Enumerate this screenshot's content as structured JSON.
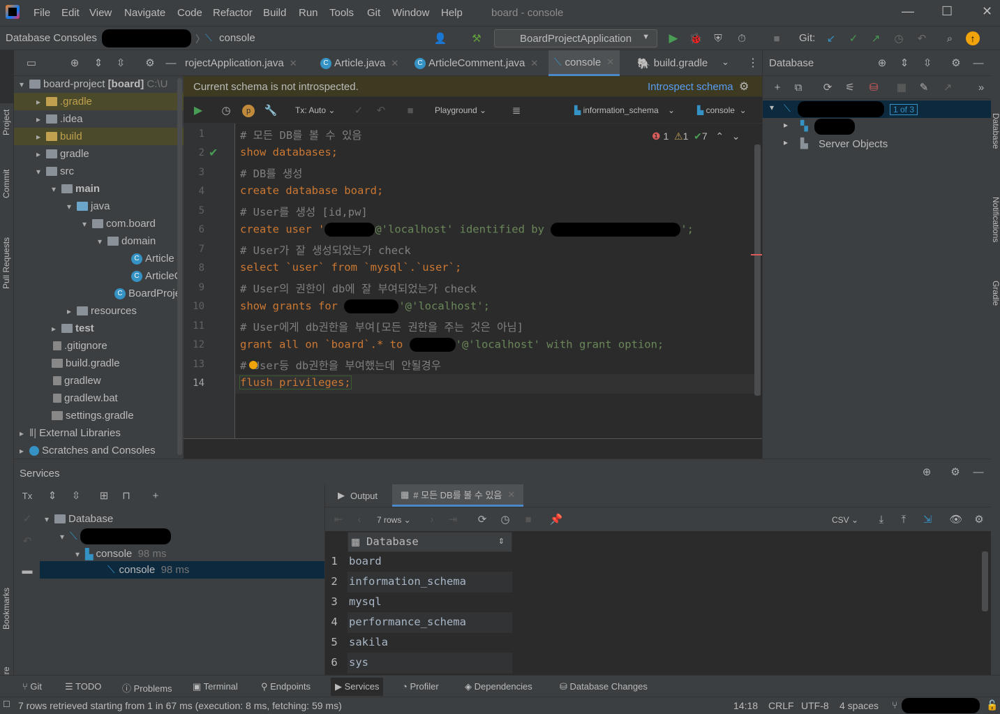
{
  "menu": [
    "File",
    "Edit",
    "View",
    "Navigate",
    "Code",
    "Refactor",
    "Build",
    "Run",
    "Tools",
    "Git",
    "Window",
    "Help"
  ],
  "window_title": "board - console",
  "breadcrumb": {
    "root": "Database Consoles",
    "leaf": "console"
  },
  "run_config": "BoardProjectApplication",
  "git_label": "Git:",
  "left_stripe": [
    "Project",
    "Commit",
    "Pull Requests",
    "Bookmarks",
    "Structure"
  ],
  "right_stripe": [
    "Database",
    "Notifications",
    "Gradle"
  ],
  "project_tree": [
    {
      "label": "board-project",
      "bold": "[board]",
      "extra": "C:\\U"
    },
    {
      "label": ".gradle"
    },
    {
      "label": ".idea"
    },
    {
      "label": "build"
    },
    {
      "label": "gradle"
    },
    {
      "label": "src"
    },
    {
      "label": "main"
    },
    {
      "label": "java"
    },
    {
      "label": "com.board"
    },
    {
      "label": "domain"
    },
    {
      "label": "Article"
    },
    {
      "label": "ArticleC"
    },
    {
      "label": "BoardProje"
    },
    {
      "label": "resources"
    },
    {
      "label": "test"
    },
    {
      "label": ".gitignore"
    },
    {
      "label": "build.gradle"
    },
    {
      "label": "gradlew"
    },
    {
      "label": "gradlew.bat"
    },
    {
      "label": "settings.gradle"
    },
    {
      "label": "External Libraries"
    },
    {
      "label": "Scratches and Consoles"
    }
  ],
  "tabs": [
    "rojectApplication.java",
    "Article.java",
    "ArticleComment.java",
    "console",
    "build.gradle"
  ],
  "schema_bar": {
    "message": "Current schema is not introspected.",
    "action": "Introspect schema"
  },
  "editor_toolbar": {
    "tx": "Tx: Auto",
    "mode": "Playground",
    "schema": "information_schema",
    "session": "console"
  },
  "inspections": {
    "errors": "1",
    "warnings": "1",
    "ok": "7"
  },
  "code_lines": [
    "# 모든 DB를 볼 수 있음",
    "show databases;",
    "# DB를 생성",
    "create database board;",
    "# User를 생성 [id,pw]",
    "create user '",
    "# User가 잘 생성되었는가 check",
    "select `user` from `mysql`.`user`;",
    "# User의 권한이 db에 잘 부여되었는가 check",
    "show grants for",
    "# User에게 db권한을 부여[모든 권한을 주는 것은 아님]",
    "grant all on `board`.* to",
    "# User등 db권한을 부여했는데 안될경우",
    "flush privileges;"
  ],
  "code_parts": {
    "l6_host": "@'localhost' identified by ",
    "l6_end": "';",
    "l10_host": "'@'localhost';",
    "l12_host": "'@'localhost' with grant option;"
  },
  "line_numbers": [
    "1",
    "2",
    "3",
    "4",
    "5",
    "6",
    "7",
    "8",
    "9",
    "10",
    "11",
    "12",
    "13",
    "14"
  ],
  "db_panel": {
    "title": "Database",
    "counter": "1 of 3",
    "server_objects": "Server Objects"
  },
  "services": {
    "title": "Services",
    "tree": [
      {
        "label": "Database"
      },
      {
        "label": "console",
        "time": "98 ms"
      },
      {
        "label": "console",
        "time": "98 ms"
      }
    ],
    "tabs": [
      "Output",
      "# 모든 DB를 볼 수 있음"
    ],
    "rows_label": "7 rows",
    "export": "CSV",
    "column": "Database",
    "rows": [
      "board",
      "information_schema",
      "mysql",
      "performance_schema",
      "sakila",
      "sys"
    ],
    "row_nums": [
      "1",
      "2",
      "3",
      "4",
      "5",
      "6"
    ]
  },
  "bottom_tools": [
    "Git",
    "TODO",
    "Problems",
    "Terminal",
    "Endpoints",
    "Services",
    "Profiler",
    "Dependencies",
    "Database Changes"
  ],
  "status": {
    "message": "7 rows retrieved starting from 1 in 67 ms (execution: 8 ms, fetching: 59 ms)",
    "pos": "14:18",
    "eol": "CRLF",
    "enc": "UTF-8",
    "indent": "4 spaces"
  }
}
